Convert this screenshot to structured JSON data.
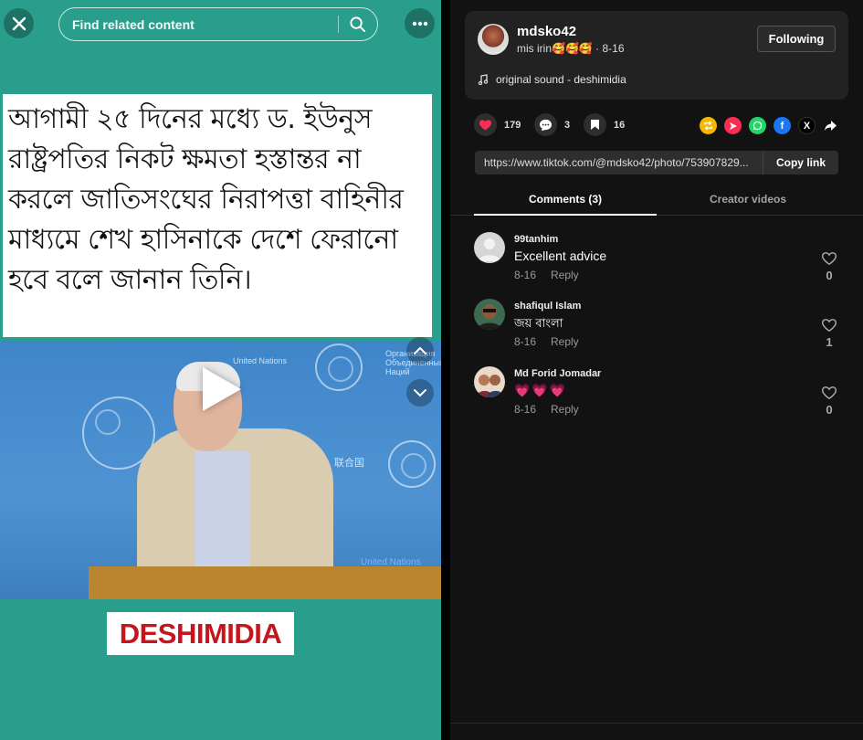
{
  "colors": {
    "left_bg": "#2a9e8c",
    "accent_pink": "#fe2c55",
    "brand_red": "#c4161c"
  },
  "top_bar": {
    "search_placeholder": "Find related content",
    "icons": [
      "close-icon",
      "search-icon",
      "more-icon"
    ]
  },
  "post": {
    "headline": "আগামী ২৫ দিনের মধ্যে ড. ইউনুস রাষ্ট্রপতির নিকট ক্ষমতা হস্তান্তর না করলে জাতিসংঘের নিরাপত্তা বাহিনীর মাধ্যমে শেখ হাসিনাকে দেশে ফেরানো হবে বলে জানান তিনি।",
    "video_overlay": {
      "un_label_left": "United Nations",
      "un_label_right_1": "Организация",
      "un_label_right_2": "Объединенных",
      "un_label_right_3": "Наций",
      "un_label_cn": "联合国",
      "podium_label": "United Nations"
    },
    "brand": "DESHIMIDIA"
  },
  "author": {
    "username": "mdsko42",
    "meta": "mis irin🥰🥰🥰 · 8-16",
    "follow_label": "Following",
    "sound": "original sound - deshimidia"
  },
  "actions": {
    "likes": "179",
    "comments": "3",
    "saves": "16",
    "share_icons": [
      "repost-icon",
      "send-icon",
      "whatsapp-icon",
      "facebook-icon",
      "x-icon",
      "share-arrow-icon"
    ]
  },
  "link": {
    "url": "https://www.tiktok.com/@mdsko42/photo/753907829...",
    "copy_label": "Copy link"
  },
  "tabs": [
    {
      "label": "Comments (3)",
      "active": true
    },
    {
      "label": "Creator videos",
      "active": false
    }
  ],
  "comments": [
    {
      "user": "99tanhim",
      "text": "Excellent advice",
      "date": "8-16",
      "reply": "Reply",
      "likes": "0"
    },
    {
      "user": "shafiqul Islam",
      "text": "জয় বাংলা",
      "date": "8-16",
      "reply": "Reply",
      "likes": "1"
    },
    {
      "user": "Md Forid Jomadar",
      "text": "💗💗💗",
      "date": "8-16",
      "reply": "Reply",
      "likes": "0"
    }
  ]
}
